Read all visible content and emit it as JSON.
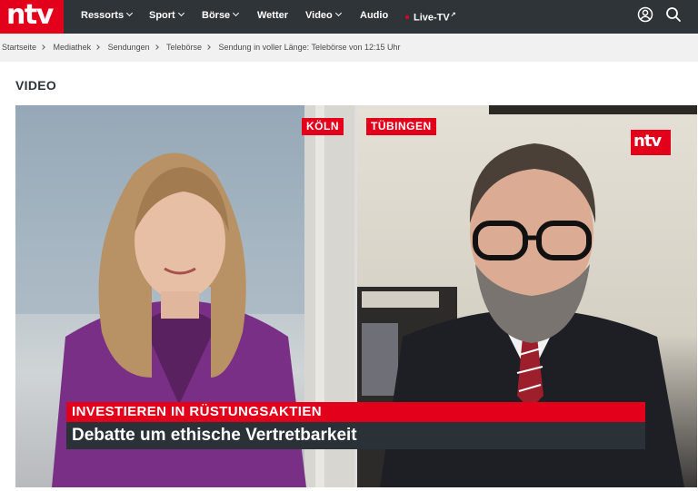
{
  "brand": {
    "logo_text": "ntv",
    "accent": "#e3001b",
    "nav_bg": "#2f3438"
  },
  "nav": {
    "items": [
      {
        "label": "Ressorts",
        "dropdown": true
      },
      {
        "label": "Sport",
        "dropdown": true
      },
      {
        "label": "Börse",
        "dropdown": true
      },
      {
        "label": "Wetter",
        "dropdown": false
      },
      {
        "label": "Video",
        "dropdown": true
      },
      {
        "label": "Audio",
        "dropdown": false
      },
      {
        "label": "Live-TV",
        "dropdown": false,
        "live": true,
        "external": true
      }
    ],
    "account_icon": "user-circle-icon",
    "search_icon": "search-icon"
  },
  "breadcrumb": [
    "Startseite",
    "Mediathek",
    "Sendungen",
    "Telebörse",
    "Sendung in voller Länge: Telebörse von 12:15 Uhr"
  ],
  "section_title": "VIDEO",
  "video": {
    "left_location": "KÖLN",
    "right_location": "TÜBINGEN",
    "corner_logo": "ntv",
    "lower_third_topline": "INVESTIEREN IN RÜSTUNGSAKTIEN",
    "lower_third_headline": "Debatte um ethische Vertretbarkeit"
  }
}
